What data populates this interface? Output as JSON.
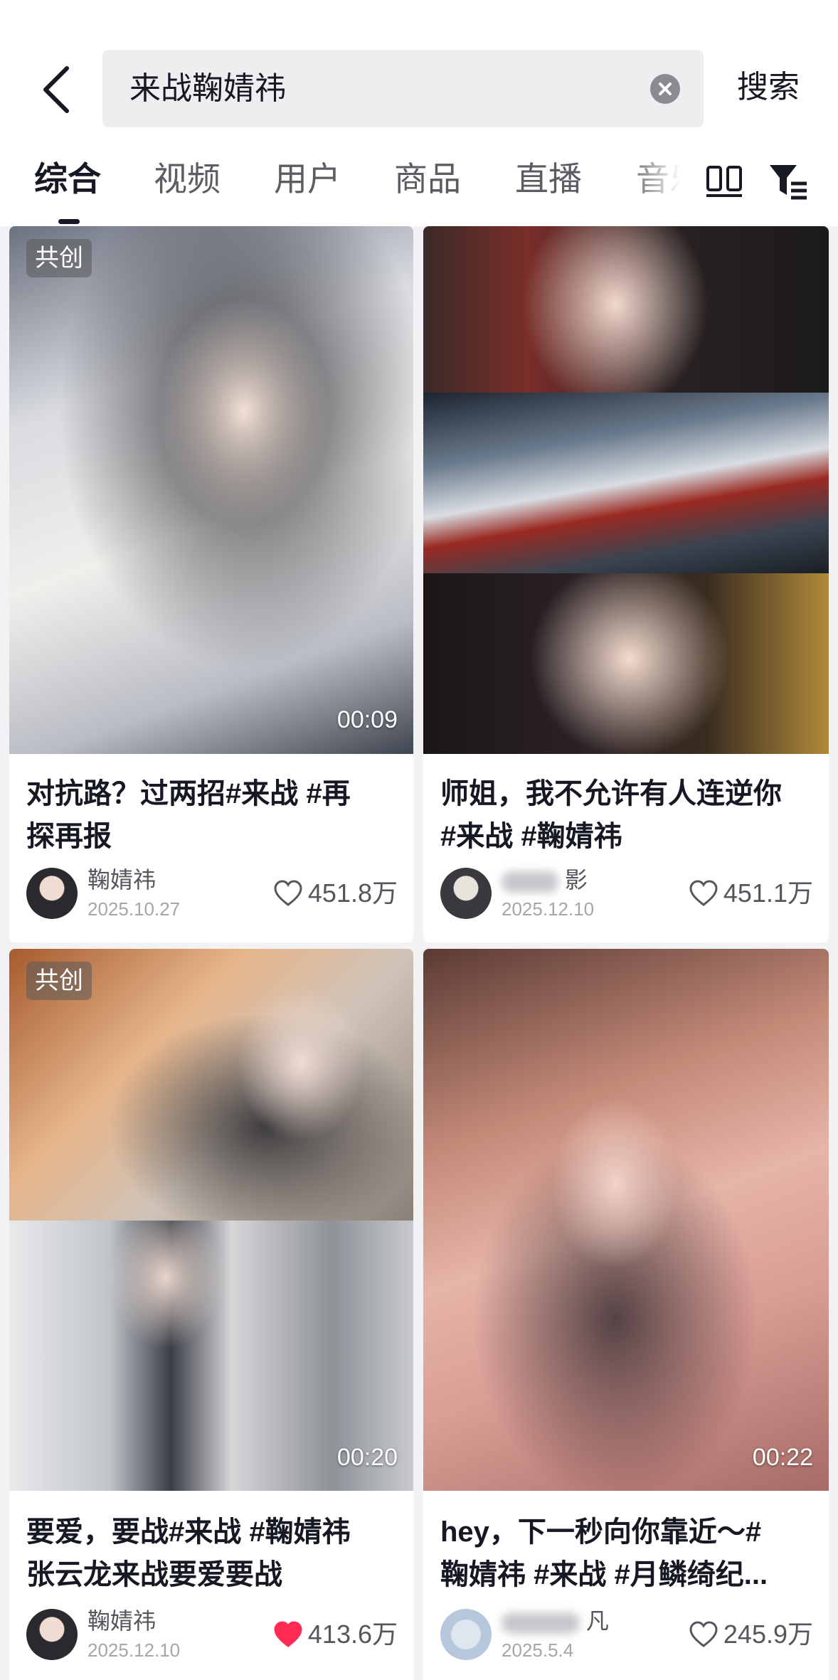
{
  "search": {
    "query": "来战鞠婧祎",
    "button_label": "搜索"
  },
  "tabs": [
    {
      "label": "综合",
      "active": true
    },
    {
      "label": "视频",
      "active": false
    },
    {
      "label": "用户",
      "active": false
    },
    {
      "label": "商品",
      "active": false
    },
    {
      "label": "直播",
      "active": false
    },
    {
      "label": "音乐",
      "active": false
    }
  ],
  "icons": {
    "back": "chevron-left-icon",
    "clear": "clear-icon",
    "layout": "grid-layout-icon",
    "filter": "filter-icon",
    "like": "heart-icon"
  },
  "colors": {
    "liked": "#fe2c55",
    "text": "#161823",
    "muted": "#55565c"
  },
  "cards": [
    {
      "badge": "共创",
      "duration": "00:09",
      "title": "对抗路？过两招#来战  #再\n探再报",
      "author": "鞠婧祎",
      "date": "2025.10.27",
      "likes": "451.8万",
      "liked": false
    },
    {
      "badge": "",
      "duration": "",
      "title": "师姐，我不允许有人连逆你\n#来战 #鞠婧祎",
      "author": "影",
      "date": "2025.12.10",
      "likes": "451.1万",
      "liked": false
    },
    {
      "badge": "共创",
      "duration": "00:20",
      "title": "要爱，要战#来战 #鞠婧祎\n张云龙来战要爱要战",
      "author": "鞠婧祎",
      "date": "2025.12.10",
      "likes": "413.6万",
      "liked": true
    },
    {
      "badge": "",
      "duration": "00:22",
      "title": "hey，下一秒向你靠近～#\n鞠婧祎 #来战 #月鳞绮纪...",
      "author": "凡",
      "date": "2025.5.4",
      "likes": "245.9万",
      "liked": false
    }
  ]
}
